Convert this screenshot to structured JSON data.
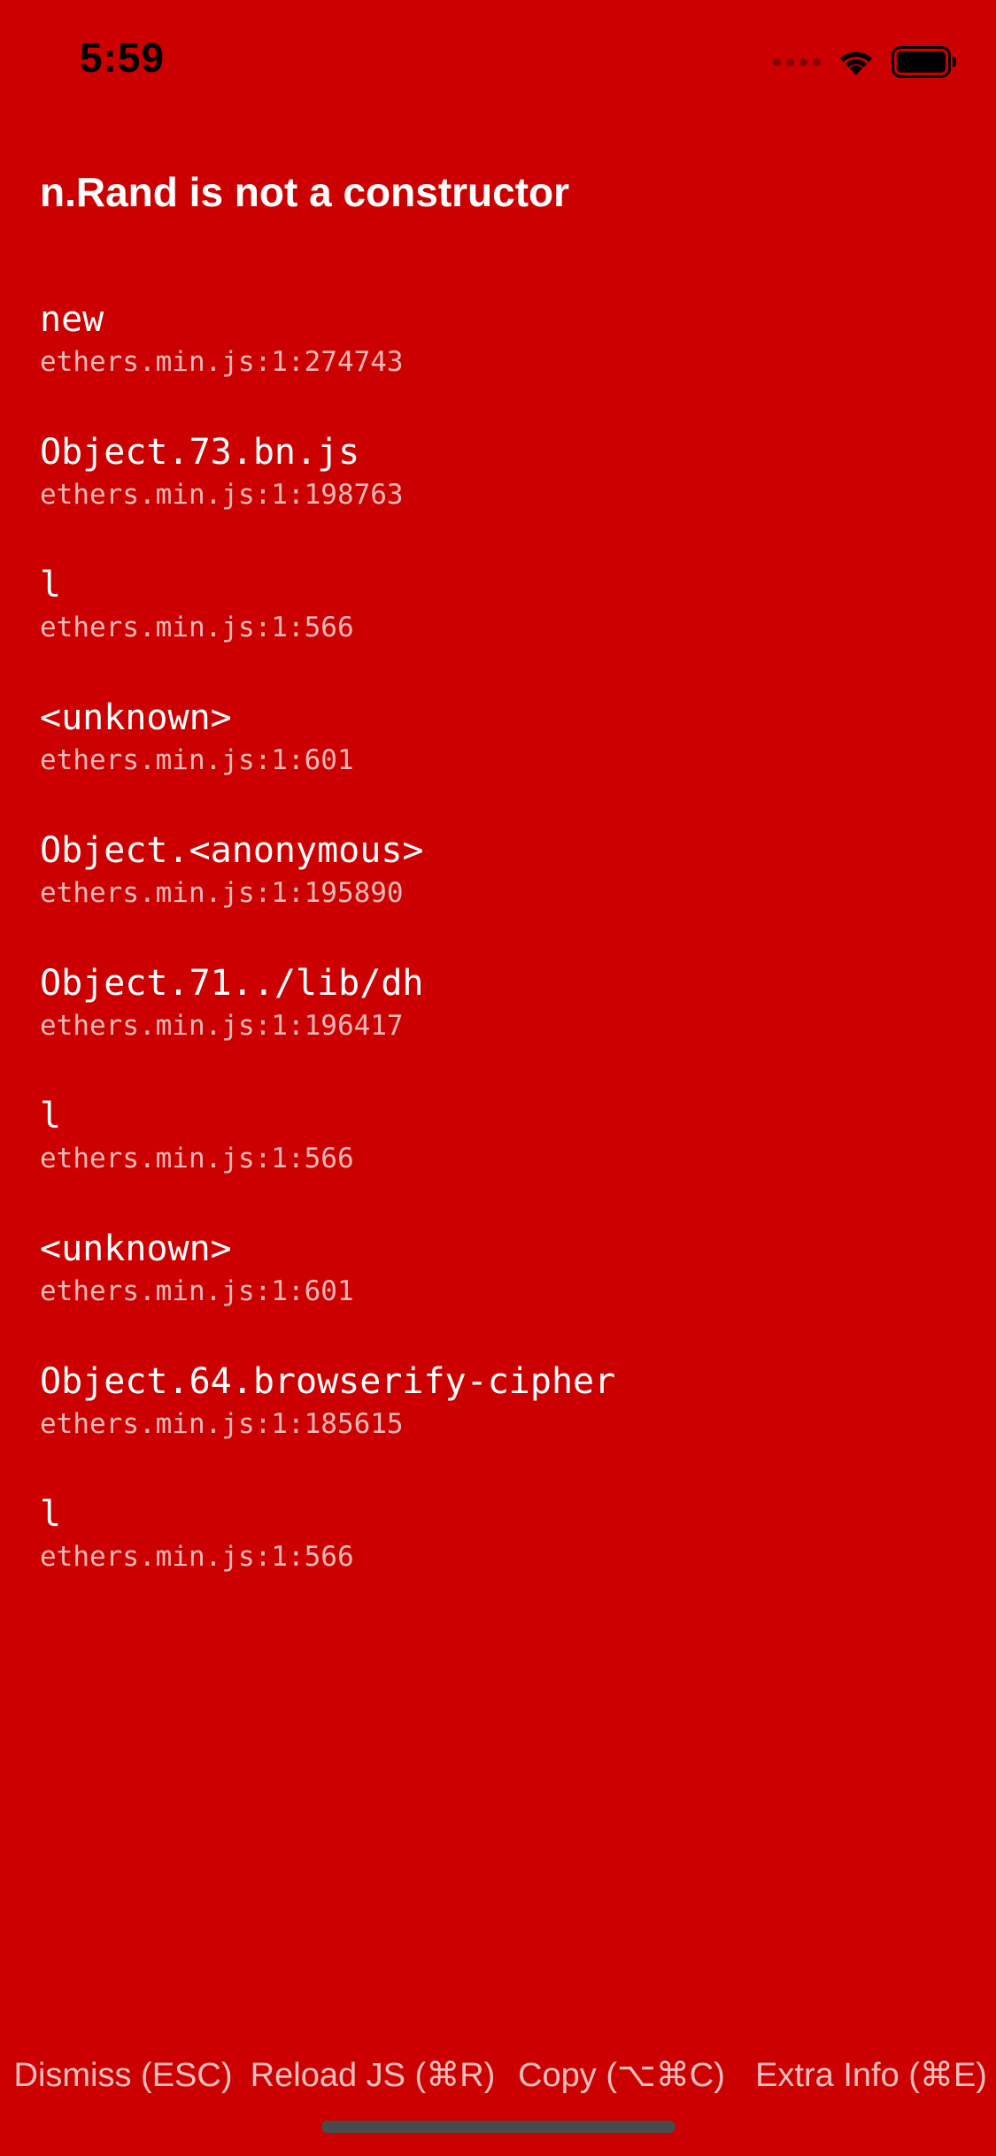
{
  "status_bar": {
    "time": "5:59",
    "wifi_icon": "wifi-icon",
    "battery_icon": "battery-full-icon",
    "signal_icon": "cellular-signal-empty-icon"
  },
  "error": {
    "message": "n.Rand is not a constructor"
  },
  "stack": [
    {
      "method": "new",
      "location": "ethers.min.js:1:274743"
    },
    {
      "method": "Object.73.bn.js",
      "location": "ethers.min.js:1:198763"
    },
    {
      "method": "l",
      "location": "ethers.min.js:1:566"
    },
    {
      "method": "<unknown>",
      "location": "ethers.min.js:1:601"
    },
    {
      "method": "Object.<anonymous>",
      "location": "ethers.min.js:1:195890"
    },
    {
      "method": "Object.71../lib/dh",
      "location": "ethers.min.js:1:196417"
    },
    {
      "method": "l",
      "location": "ethers.min.js:1:566"
    },
    {
      "method": "<unknown>",
      "location": "ethers.min.js:1:601"
    },
    {
      "method": "Object.64.browserify-cipher",
      "location": "ethers.min.js:1:185615"
    },
    {
      "method": "l",
      "location": "ethers.min.js:1:566"
    }
  ],
  "toolbar": {
    "dismiss_label": "Dismiss (ESC)",
    "reload_label": "Reload JS (⌘R)",
    "copy_label": "Copy (⌥⌘C)",
    "extra_info_label": "Extra Info (⌘E)"
  },
  "colors": {
    "background": "#cc0000",
    "text": "#ffffff",
    "status_text": "#000000"
  }
}
